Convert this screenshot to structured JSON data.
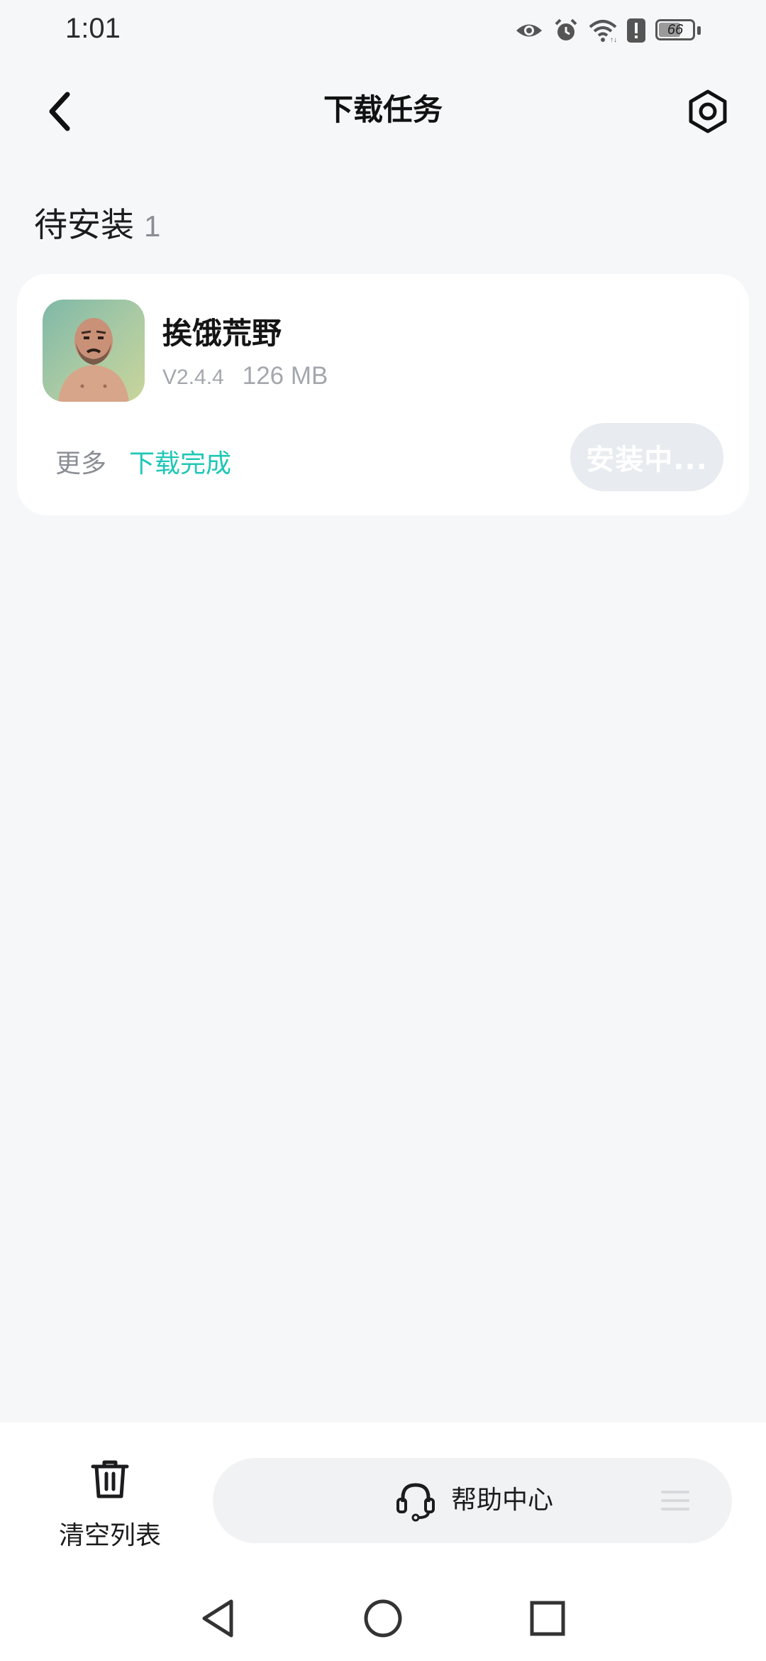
{
  "status_bar": {
    "time": "1:01",
    "battery_level": "66",
    "icons": [
      "eye-icon",
      "alarm-icon",
      "wifi-icon",
      "alert-icon",
      "battery-icon"
    ]
  },
  "header": {
    "title": "下载任务",
    "back_icon": "chevron-left-icon",
    "settings_icon": "hexagon-settings-icon"
  },
  "section": {
    "title": "待安装",
    "count": "1"
  },
  "task": {
    "app_name": "挨饿荒野",
    "version": "V2.4.4",
    "size": "126 MB",
    "more_label": "更多",
    "status_label": "下载完成",
    "install_label": "安装中...",
    "status_color": "#1fc7b6"
  },
  "bottom_bar": {
    "clear_label": "清空列表",
    "help_label": "帮助中心"
  },
  "nav": {
    "icons": [
      "triangle-back-icon",
      "circle-home-icon",
      "square-recents-icon"
    ]
  }
}
